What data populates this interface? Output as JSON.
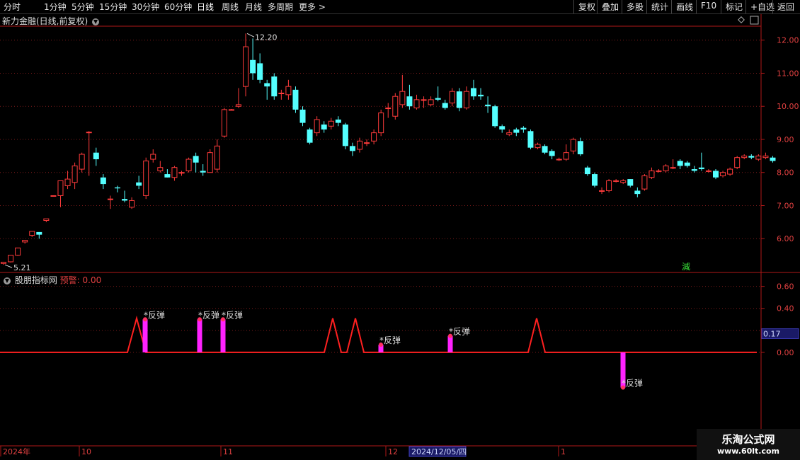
{
  "toolbar": {
    "periods": [
      "分时",
      "1分钟",
      "5分钟",
      "15分钟",
      "30分钟",
      "60分钟",
      "日线",
      "周线",
      "月线",
      "多周期",
      "更多 >"
    ],
    "active_period": "日线",
    "right_buttons": [
      "复权",
      "叠加",
      "多股",
      "统计",
      "画线",
      "F10",
      "标记",
      "+自选",
      "返回"
    ]
  },
  "main_title": "新力金融(日线,前复权)",
  "indicator": {
    "name": "股朋指标网",
    "warn_label": "预警: 0.00"
  },
  "colors": {
    "up": "#ff3b3b",
    "down": "#54ffff",
    "axis": "#b01818",
    "grid": "#7a1a1a",
    "signal_line": "#ff2020",
    "bar": "#ff22ff"
  },
  "chart_data": [
    {
      "type": "candlestick",
      "ylim": [
        5.0,
        12.4
      ],
      "y_ticks": [
        "12.00",
        "11.00",
        "10.00",
        "9.00",
        "8.00",
        "7.00",
        "6.00"
      ],
      "annotations": {
        "high_label": "12.20",
        "low_label": "5.21",
        "marker": "減"
      },
      "candles": [
        [
          5.25,
          5.29,
          5.21,
          5.28
        ],
        [
          5.3,
          5.5,
          5.28,
          5.48
        ],
        [
          5.5,
          5.72,
          5.48,
          5.68
        ],
        [
          5.9,
          5.95,
          5.85,
          5.92
        ],
        [
          6.1,
          6.22,
          6.05,
          6.18
        ],
        [
          6.2,
          6.12,
          6.0,
          6.15
        ],
        [
          6.55,
          6.6,
          6.5,
          6.58
        ],
        [
          7.3,
          7.3,
          7.28,
          7.31
        ],
        [
          7.3,
          7.75,
          6.95,
          7.7
        ],
        [
          7.6,
          7.8,
          7.5,
          8.05
        ],
        [
          7.7,
          8.2,
          7.5,
          8.3
        ],
        [
          8.1,
          8.55,
          8.0,
          8.6
        ],
        [
          9.2,
          9.22,
          7.9,
          9.25
        ],
        [
          8.6,
          8.4,
          8.2,
          8.75
        ],
        [
          7.85,
          7.65,
          7.5,
          7.95
        ],
        [
          7.2,
          7.2,
          6.9,
          7.3
        ],
        [
          7.55,
          7.52,
          7.4,
          7.6
        ],
        [
          7.2,
          7.15,
          7.1,
          7.45
        ],
        [
          6.95,
          7.15,
          6.9,
          7.25
        ],
        [
          7.7,
          7.6,
          7.5,
          7.9
        ],
        [
          7.3,
          8.35,
          7.2,
          8.45
        ],
        [
          8.4,
          8.55,
          8.3,
          8.7
        ],
        [
          8.05,
          8.15,
          8.0,
          8.35
        ],
        [
          7.95,
          7.85,
          7.85,
          8.1
        ],
        [
          7.85,
          8.15,
          7.75,
          8.2
        ],
        [
          8.0,
          8.0,
          7.9,
          8.05
        ],
        [
          8.05,
          8.4,
          8.0,
          8.45
        ],
        [
          8.5,
          8.3,
          8.0,
          8.6
        ],
        [
          8.05,
          8.0,
          7.9,
          8.25
        ],
        [
          8.0,
          8.6,
          8.0,
          8.7
        ],
        [
          8.1,
          8.8,
          8.0,
          9.0
        ],
        [
          9.1,
          9.9,
          9.05,
          9.95
        ],
        [
          9.9,
          9.9,
          9.88,
          9.92
        ],
        [
          10.0,
          10.05,
          9.95,
          10.55
        ],
        [
          10.6,
          11.8,
          10.3,
          12.2
        ],
        [
          11.4,
          11.0,
          10.8,
          12.05
        ],
        [
          11.3,
          10.8,
          10.7,
          11.6
        ],
        [
          10.7,
          10.6,
          10.2,
          10.8
        ],
        [
          10.9,
          10.3,
          10.2,
          11.0
        ],
        [
          10.4,
          10.4,
          10.2,
          10.5
        ],
        [
          10.35,
          10.6,
          10.2,
          10.8
        ],
        [
          10.5,
          9.9,
          9.8,
          10.6
        ],
        [
          9.9,
          9.5,
          9.4,
          10.0
        ],
        [
          9.3,
          8.9,
          8.85,
          9.35
        ],
        [
          9.2,
          9.6,
          9.1,
          9.7
        ],
        [
          9.45,
          9.3,
          9.2,
          9.55
        ],
        [
          9.4,
          9.55,
          9.3,
          9.65
        ],
        [
          9.6,
          9.5,
          9.4,
          9.7
        ],
        [
          9.45,
          8.8,
          8.7,
          9.5
        ],
        [
          8.8,
          8.65,
          8.5,
          8.9
        ],
        [
          8.7,
          8.95,
          8.6,
          9.05
        ],
        [
          8.9,
          8.9,
          8.8,
          9.0
        ],
        [
          8.95,
          9.2,
          8.85,
          9.3
        ],
        [
          9.2,
          9.8,
          9.1,
          9.9
        ],
        [
          9.95,
          9.95,
          9.65,
          10.1
        ],
        [
          9.7,
          10.3,
          9.6,
          10.4
        ],
        [
          10.05,
          10.45,
          9.95,
          10.95
        ],
        [
          10.3,
          10.0,
          9.9,
          10.65
        ],
        [
          9.95,
          10.2,
          9.9,
          10.35
        ],
        [
          10.2,
          10.2,
          9.95,
          10.3
        ],
        [
          10.05,
          10.2,
          10.0,
          10.3
        ],
        [
          10.25,
          10.2,
          10.15,
          10.6
        ],
        [
          10.1,
          9.95,
          9.9,
          10.2
        ],
        [
          10.1,
          10.45,
          10.0,
          10.55
        ],
        [
          10.45,
          9.95,
          9.85,
          10.55
        ],
        [
          9.95,
          10.45,
          9.9,
          10.6
        ],
        [
          10.55,
          10.3,
          10.2,
          10.8
        ],
        [
          10.35,
          10.3,
          10.2,
          10.55
        ],
        [
          10.05,
          10.0,
          9.8,
          10.3
        ],
        [
          10.0,
          9.4,
          9.35,
          10.05
        ],
        [
          9.4,
          9.3,
          9.2,
          9.45
        ],
        [
          9.15,
          9.2,
          9.1,
          9.3
        ],
        [
          9.3,
          9.2,
          9.1,
          9.35
        ],
        [
          9.35,
          9.3,
          9.2,
          9.4
        ],
        [
          9.25,
          8.75,
          8.7,
          9.3
        ],
        [
          8.75,
          8.85,
          8.7,
          8.9
        ],
        [
          8.8,
          8.6,
          8.55,
          8.85
        ],
        [
          8.65,
          8.5,
          8.4,
          8.7
        ],
        [
          8.4,
          8.4,
          8.35,
          8.45
        ],
        [
          8.4,
          8.6,
          8.35,
          8.85
        ],
        [
          8.65,
          9.0,
          8.55,
          9.05
        ],
        [
          8.95,
          8.55,
          8.5,
          9.05
        ],
        [
          8.15,
          7.95,
          7.9,
          8.2
        ],
        [
          7.95,
          7.6,
          7.55,
          8.0
        ],
        [
          7.45,
          7.45,
          7.35,
          7.55
        ],
        [
          7.45,
          7.75,
          7.4,
          7.8
        ],
        [
          7.75,
          7.75,
          7.7,
          7.8
        ],
        [
          7.7,
          7.75,
          7.65,
          7.8
        ],
        [
          7.8,
          7.6,
          7.55,
          7.8
        ],
        [
          7.45,
          7.35,
          7.25,
          7.55
        ],
        [
          7.5,
          7.9,
          7.45,
          7.95
        ],
        [
          7.85,
          8.05,
          7.8,
          8.15
        ],
        [
          8.05,
          8.05,
          8.0,
          8.1
        ],
        [
          8.05,
          8.2,
          8.0,
          8.25
        ],
        [
          8.15,
          8.15,
          8.1,
          8.4
        ],
        [
          8.35,
          8.2,
          8.1,
          8.4
        ],
        [
          8.3,
          8.2,
          8.15,
          8.35
        ],
        [
          8.1,
          8.05,
          8.0,
          8.2
        ],
        [
          8.15,
          8.1,
          8.05,
          8.6
        ],
        [
          8.05,
          8.05,
          8.0,
          8.1
        ],
        [
          8.05,
          7.85,
          7.8,
          8.1
        ],
        [
          7.9,
          8.0,
          7.85,
          8.05
        ],
        [
          7.95,
          8.1,
          7.9,
          8.15
        ],
        [
          8.15,
          8.45,
          8.1,
          8.5
        ],
        [
          8.45,
          8.5,
          8.4,
          8.55
        ],
        [
          8.5,
          8.45,
          8.4,
          8.55
        ],
        [
          8.4,
          8.5,
          8.35,
          8.55
        ],
        [
          8.45,
          8.5,
          8.4,
          8.6
        ],
        [
          8.45,
          8.35,
          8.3,
          8.5
        ]
      ]
    },
    {
      "type": "line",
      "ylim": [
        -0.85,
        0.72
      ],
      "y_ticks": [
        "0.60",
        "0.40",
        "0.20",
        "0.00"
      ],
      "current_value": "0.17",
      "signal_line": [
        [
          0,
          0
        ],
        [
          180,
          0
        ],
        [
          193,
          0.31
        ],
        [
          206,
          0
        ],
        [
          458,
          0
        ],
        [
          470,
          0.31
        ],
        [
          482,
          0
        ],
        [
          490,
          0
        ],
        [
          502,
          0.31
        ],
        [
          514,
          0
        ],
        [
          746,
          0
        ],
        [
          758,
          0.31
        ],
        [
          770,
          0
        ],
        [
          1069,
          0
        ]
      ],
      "bars": [
        {
          "x": 205,
          "value": 0.3,
          "label": "反弹"
        },
        {
          "x": 282,
          "value": 0.3,
          "label": "反弹"
        },
        {
          "x": 315,
          "value": 0.3,
          "label": "反弹"
        },
        {
          "x": 538,
          "value": 0.07,
          "label": "反弹"
        },
        {
          "x": 636,
          "value": 0.15,
          "label": "反弹"
        },
        {
          "x": 880,
          "value": -0.32,
          "label": "反弹"
        }
      ]
    }
  ],
  "time_axis": [
    {
      "label": "2024年",
      "x": 4
    },
    {
      "label": "10",
      "x": 115
    },
    {
      "label": "11",
      "x": 315
    },
    {
      "label": "12",
      "x": 548
    },
    {
      "label": "1",
      "x": 792
    }
  ],
  "date_cursor": "2024/12/05/四",
  "watermark": {
    "line1": "乐淘公式网",
    "line2": "www.60lt.com"
  }
}
